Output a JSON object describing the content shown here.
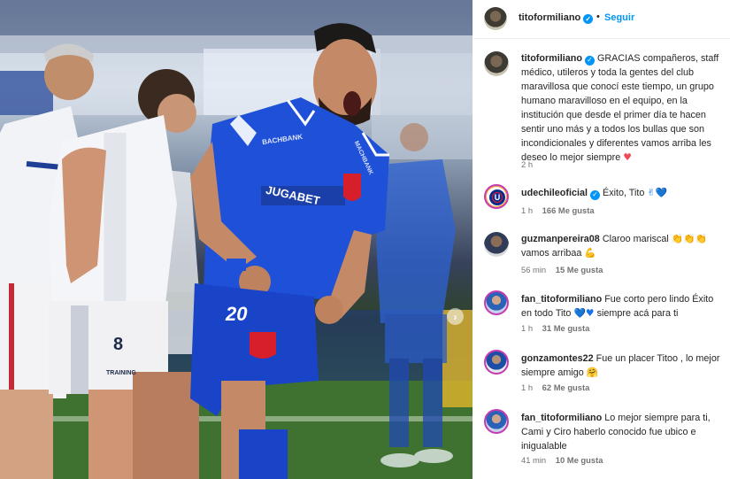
{
  "post": {
    "author": "titoformiliano",
    "follow_label": "Seguir",
    "separator": "•",
    "photo_texts": {
      "sponsor_chest": "JUGABET",
      "sponsor_sleeve": "BACHBANK",
      "sponsor_side": "MACHBANK",
      "shorts_number": "20",
      "opponent_short_number": "8",
      "opponent_brand": "TRAINING"
    },
    "icons": {
      "verified": "verified-badge-icon",
      "carousel_next": "chevron-right-icon"
    },
    "colors": {
      "accent": "#0095f6",
      "uchile_blue": "#1a45c8",
      "heart_red": "#ed4956"
    }
  },
  "caption": {
    "user": "titoformiliano",
    "text": "GRACIAS compañeros, staff médico, utileros y toda la gentes del club maravillosa que conocí este tiempo, un grupo humano maravilloso en el equipo, en la institución que desde el primer día te hacen sentir uno más y a todos los bullas que son incondicionales y diferentes vamos arriba les deseo lo mejor siempre",
    "emoji": "♥",
    "time": "2 h"
  },
  "comments": [
    {
      "user": "udechileoficial",
      "verified": true,
      "text": "Éxito, Tito",
      "emoji": "✌💙",
      "time": "1 h",
      "likes": "166 Me gusta"
    },
    {
      "user": "guzmanpereira08",
      "verified": false,
      "text": "Claroo mariscal",
      "emoji": "👏👏👏",
      "text2": "vamos arribaa",
      "emoji2": "💪",
      "time": "56 min",
      "likes": "15 Me gusta"
    },
    {
      "user": "fan_titoformiliano",
      "verified": false,
      "text": "Fue corto pero lindo Éxito en todo Tito",
      "emoji": "💙♥",
      "text2": "siempre acá para ti",
      "time": "1 h",
      "likes": "31 Me gusta"
    },
    {
      "user": "gonzamontes22",
      "verified": false,
      "text": "Fue un placer Titoo , lo mejor siempre amigo",
      "emoji": "🤗",
      "time": "1 h",
      "likes": "62 Me gusta"
    },
    {
      "user": "fan_titoformiliano",
      "verified": false,
      "text": "Lo mejor siempre para ti, Cami y Ciro haberlo conocido fue ubico e inigualable",
      "time": "41 min",
      "likes": "10 Me gusta"
    }
  ]
}
